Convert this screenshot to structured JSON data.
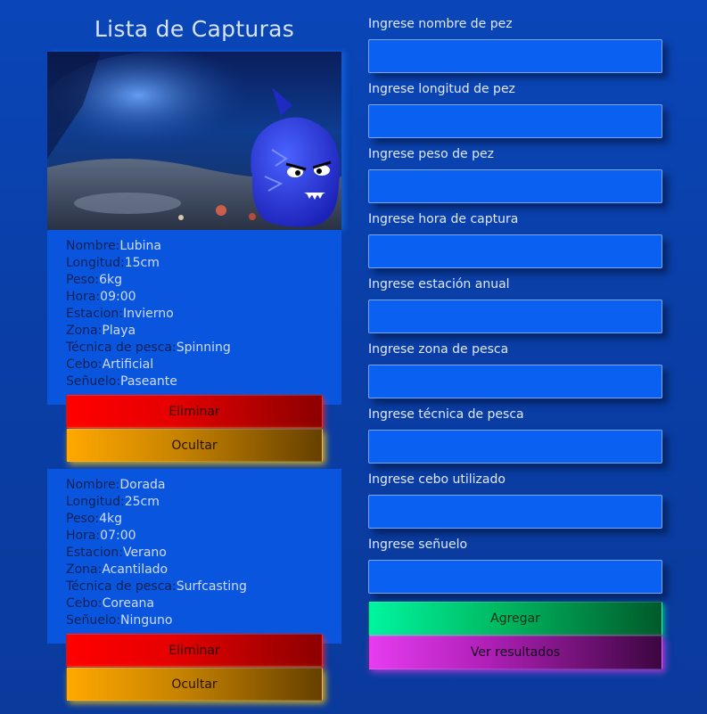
{
  "header": {
    "title": "Lista de Capturas"
  },
  "catches": [
    {
      "fields": [
        {
          "key": "Nombre:",
          "value": "Lubina"
        },
        {
          "key": "Longitud:",
          "value": "15cm"
        },
        {
          "key": "Peso:",
          "value": "6kg"
        },
        {
          "key": "Hora:",
          "value": "09:00"
        },
        {
          "key": "Estacion:",
          "value": "Invierno"
        },
        {
          "key": "Zona:",
          "value": "Playa"
        },
        {
          "key": "Técnica de pesca:",
          "value": "Spinning"
        },
        {
          "key": "Cebo:",
          "value": "Artificial"
        },
        {
          "key": "Señuelo:",
          "value": "Paseante"
        }
      ],
      "delete_label": "Eliminar",
      "hide_label": "Ocultar"
    },
    {
      "fields": [
        {
          "key": "Nombre:",
          "value": "Dorada"
        },
        {
          "key": "Longitud:",
          "value": "25cm"
        },
        {
          "key": "Peso:",
          "value": "4kg"
        },
        {
          "key": "Hora:",
          "value": "07:00"
        },
        {
          "key": "Estacion:",
          "value": "Verano"
        },
        {
          "key": "Zona:",
          "value": "Acantilado"
        },
        {
          "key": "Técnica de pesca:",
          "value": "Surfcasting"
        },
        {
          "key": "Cebo:",
          "value": "Coreana"
        },
        {
          "key": "Señuelo:",
          "value": "Ninguno"
        }
      ],
      "delete_label": "Eliminar",
      "hide_label": "Ocultar"
    }
  ],
  "form": {
    "fields": [
      {
        "label": "Ingrese nombre de pez",
        "value": ""
      },
      {
        "label": "Ingrese longitud de pez",
        "value": ""
      },
      {
        "label": "Ingrese peso de pez",
        "value": ""
      },
      {
        "label": "Ingrese hora de captura",
        "value": ""
      },
      {
        "label": "Ingrese estación anual",
        "value": ""
      },
      {
        "label": "Ingrese zona de pesca",
        "value": ""
      },
      {
        "label": "Ingrese técnica de pesca",
        "value": ""
      },
      {
        "label": "Ingrese cebo utilizado",
        "value": ""
      },
      {
        "label": "Ingrese señuelo",
        "value": ""
      }
    ],
    "add_label": "Agregar",
    "results_label": "Ver resultados"
  },
  "colors": {
    "background": "#0a46b8",
    "card": "#0a55de",
    "input": "#0a60f0",
    "delete": "#ff0000",
    "hide": "#ffa800",
    "add": "#00f5a0",
    "results": "#e63cf0"
  },
  "icons": {
    "photo": "underwater-shark-mascot-image"
  }
}
